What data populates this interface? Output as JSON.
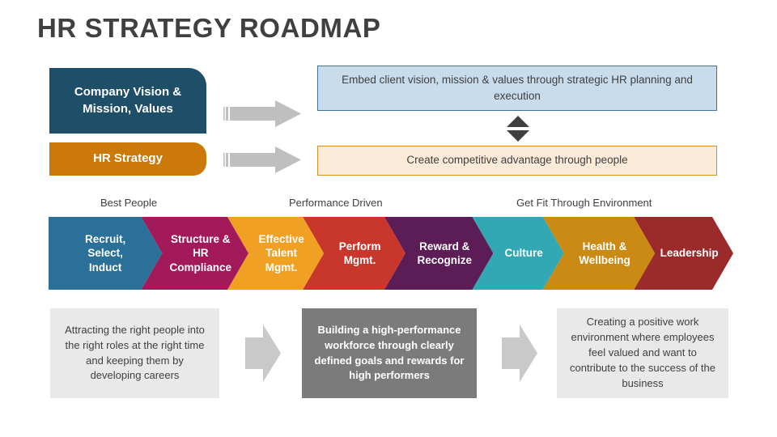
{
  "title": "HR STRATEGY ROADMAP",
  "top_section": {
    "vision_block": {
      "label": "Company Vision &\nMission, Values",
      "color": "#1F4E68"
    },
    "hr_strategy_block": {
      "label": "HR Strategy",
      "color": "#CB7A09"
    },
    "vision_statement": {
      "text": "Embed client vision, mission & values through strategic HR planning and execution",
      "fill": "#C8DCEC",
      "border": "#41719C"
    },
    "strategy_statement": {
      "text": "Create competitive advantage through people",
      "fill": "#FCEBD8",
      "border": "#D98F23"
    },
    "arrow_color": "#BFBFBF",
    "triangle_color": "#404040"
  },
  "categories": [
    {
      "label": "Best People"
    },
    {
      "label": "Performance Driven"
    },
    {
      "label": "Get Fit Through Environment"
    }
  ],
  "chevrons": [
    {
      "label": "Recruit,\nSelect,\nInduct",
      "color": "#2A7099"
    },
    {
      "label": "Structure &\nHR\nCompliance",
      "color": "#A31A5B"
    },
    {
      "label": "Effective\nTalent\nMgmt.",
      "color": "#F0A124"
    },
    {
      "label": "Perform\nMgmt.",
      "color": "#C9372C"
    },
    {
      "label": "Reward &\nRecognize",
      "color": "#5C1C56"
    },
    {
      "label": "Culture",
      "color": "#31A8B3"
    },
    {
      "label": "Health &\nWellbeing",
      "color": "#CB8A14"
    },
    {
      "label": "Leadership",
      "color": "#9B2A2A"
    }
  ],
  "descriptions": [
    {
      "text": "Attracting the right people into the right roles at the right time and keeping them by developing careers",
      "style": "light"
    },
    {
      "text": "Building a high-performance workforce through clearly defined goals and rewards for high performers",
      "style": "dark"
    },
    {
      "text": "Creating a positive work environment where employees feel valued and want to contribute to the success of the business",
      "style": "light"
    }
  ],
  "bottom_arrow_color": "#C9C9C9"
}
